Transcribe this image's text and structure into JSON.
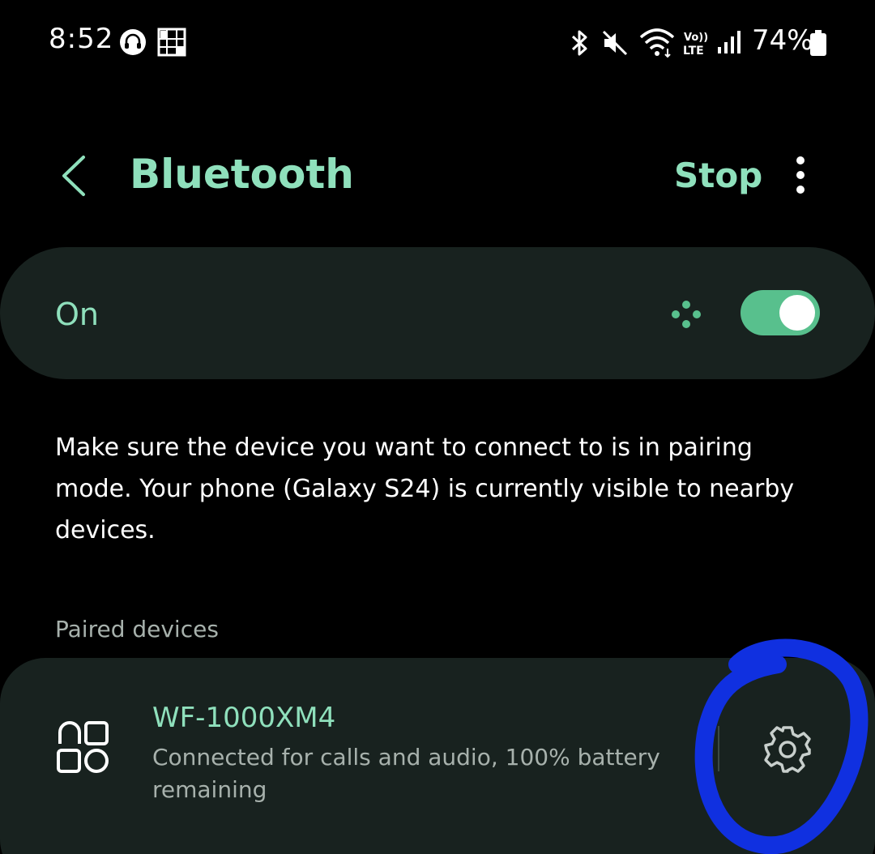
{
  "status_bar": {
    "time": "8:52",
    "battery": "74%",
    "icons": [
      "headphones-icon",
      "gallery-icon",
      "bluetooth-icon",
      "mute-icon",
      "wifi-icon",
      "volte-lte-icon",
      "signal-icon",
      "battery-icon"
    ]
  },
  "header": {
    "title": "Bluetooth",
    "stop_label": "Stop"
  },
  "bluetooth_toggle": {
    "label": "On",
    "state": true
  },
  "description": "Make sure the device you want to connect to is in pairing mode. Your phone (Galaxy S24) is currently visible to nearby devices.",
  "paired_devices": {
    "header": "Paired devices",
    "items": [
      {
        "name": "WF-1000XM4",
        "status": "Connected for calls and audio, 100% battery remaining",
        "icon": "earbuds-device-icon"
      }
    ]
  },
  "colors": {
    "accent": "#8fe0bc",
    "toggle_on": "#58c08d",
    "card_bg": "#18221f",
    "annotation": "#1030e0"
  }
}
